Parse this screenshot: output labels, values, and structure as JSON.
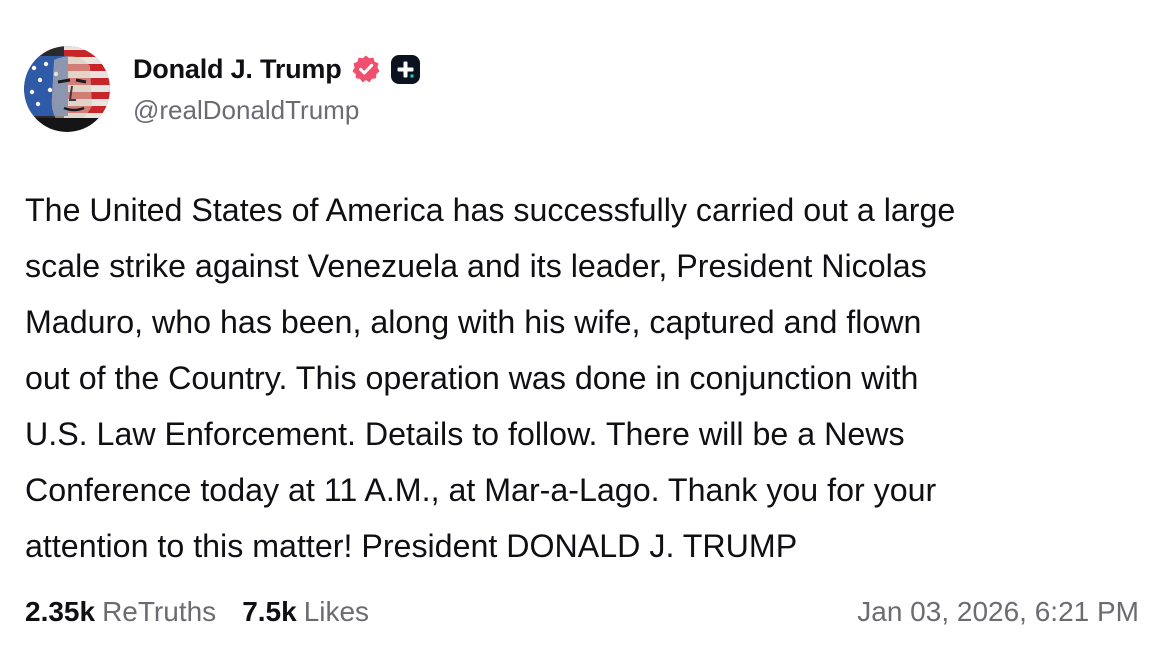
{
  "author": {
    "display_name": "Donald J. Trump",
    "handle": "@realDonaldTrump",
    "avatar_icon": "portrait-avatar-flag",
    "verified_icon": "verified-badge-icon",
    "plus_icon": "plus-badge-icon"
  },
  "post": {
    "text": "The United States of America has successfully carried out a large\nscale strike against Venezuela and its leader, President Nicolas\nMaduro, who has been, along with his wife, captured and flown\nout of the Country. This operation was done in conjunction with\nU.S. Law Enforcement. Details to follow. There will be a News\nConference today at 11 A.M., at Mar-a-Lago. Thank you for your\nattention to this matter! President DONALD J. TRUMP"
  },
  "stats": {
    "retruths_count": "2.35k",
    "retruths_label": "ReTruths",
    "likes_count": "7.5k",
    "likes_label": "Likes"
  },
  "timestamp": "Jan 03, 2026, 6:21 PM",
  "colors": {
    "text": "#0f0f14",
    "muted": "#6b6b73",
    "verified": "#f0506e",
    "badge": "#0b1220"
  }
}
